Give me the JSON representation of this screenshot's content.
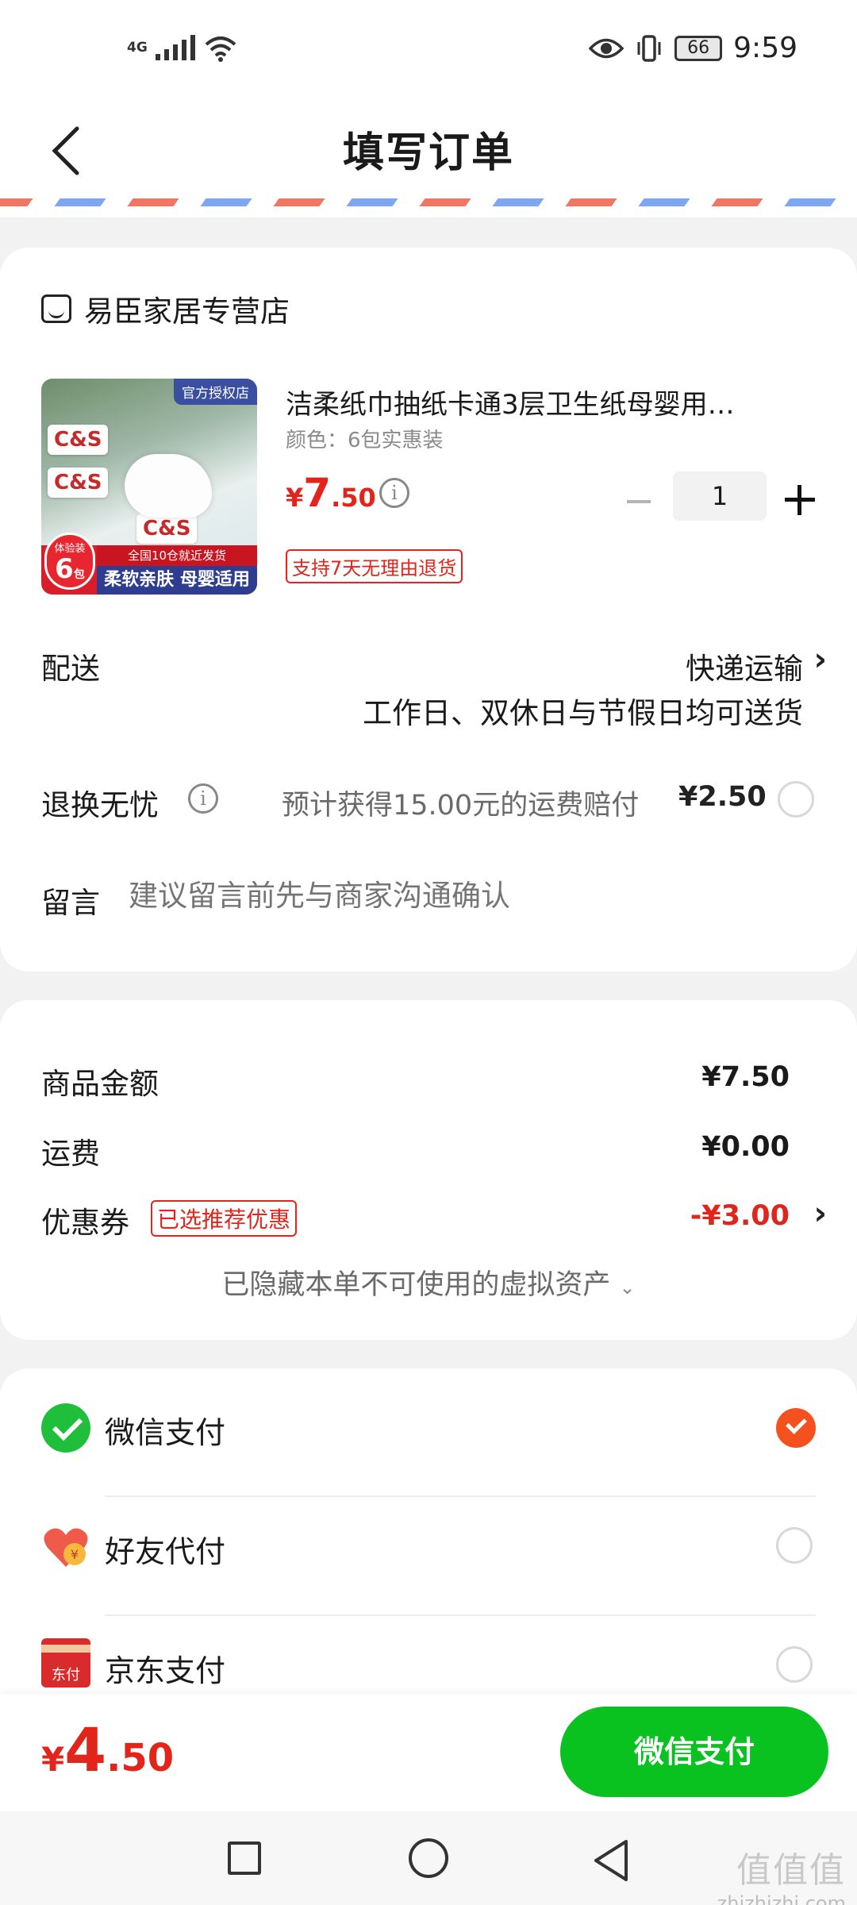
{
  "status_bar": {
    "network": "4G",
    "time": "9:59",
    "battery": "66"
  },
  "header": {
    "title": "填写订单"
  },
  "store": {
    "name": "易臣家居专营店"
  },
  "product": {
    "image_badge": "官方授权店",
    "image_brand": "C&S",
    "image_strip_top": "全国10仓就近发货",
    "image_strip_bottom": "柔软亲肤 母婴适用",
    "image_circle_small": "体验装",
    "image_circle_num": "6",
    "image_circle_unit": "包",
    "title": "洁柔纸巾抽纸卡通3层卫生纸母婴用…",
    "spec": "颜色：6包实惠装",
    "price_currency": "¥",
    "price_int": "7",
    "price_dec": ".50",
    "quantity": "1",
    "return_tag": "支持7天无理由退货"
  },
  "shipping": {
    "label": "配送",
    "method": "快递运输",
    "note": "工作日、双休日与节假日均可送货"
  },
  "exchange": {
    "label": "退换无忧",
    "desc": "预计获得15.00元的运费赔付",
    "price": "¥2.50"
  },
  "message": {
    "label": "留言",
    "placeholder": "建议留言前先与商家沟通确认"
  },
  "summary": {
    "goods_label": "商品金额",
    "goods_value": "¥7.50",
    "freight_label": "运费",
    "freight_value": "¥0.00",
    "coupon_label": "优惠券",
    "coupon_tag": "已选推荐优惠",
    "coupon_value": "-¥3.00",
    "hidden_assets": "已隐藏本单不可使用的虚拟资产"
  },
  "payment": {
    "methods": [
      {
        "label": "微信支付",
        "icon": "wechat-pay-icon",
        "selected": true
      },
      {
        "label": "好友代付",
        "icon": "friend-pay-icon",
        "selected": false
      },
      {
        "label": "京东支付",
        "icon": "jd-pay-icon",
        "icon_text": "东付",
        "selected": false
      }
    ]
  },
  "bottom": {
    "total_currency": "¥",
    "total_int": "4",
    "total_dec": ".50",
    "pay_button": "微信支付"
  },
  "watermark": {
    "big": "值值值",
    "small": "zhizhizhi.com"
  },
  "colors": {
    "accent_red": "#e1251b",
    "wechat_green": "#09c11f",
    "selected_orange": "#f4511e"
  }
}
